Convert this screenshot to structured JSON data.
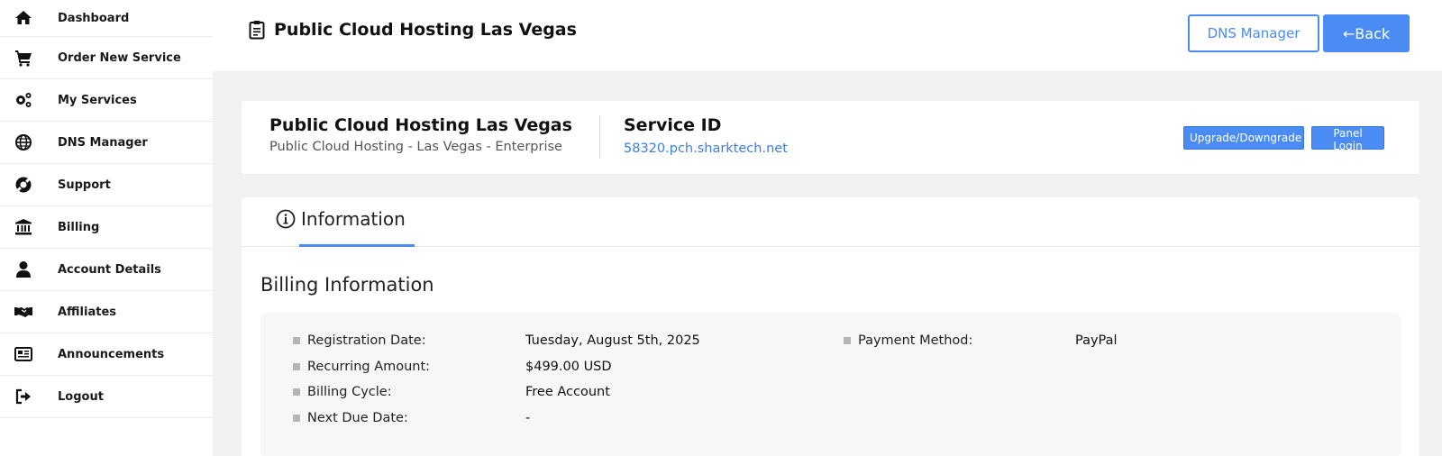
{
  "sidebar": {
    "items": [
      {
        "label": "Dashboard",
        "icon": "home-icon"
      },
      {
        "label": "Order New Service",
        "icon": "cart-icon"
      },
      {
        "label": "My Services",
        "icon": "gears-icon"
      },
      {
        "label": "DNS Manager",
        "icon": "globe-icon"
      },
      {
        "label": "Support",
        "icon": "lifebuoy-icon"
      },
      {
        "label": "Billing",
        "icon": "bank-icon"
      },
      {
        "label": "Account Details",
        "icon": "user-icon"
      },
      {
        "label": "Affiliates",
        "icon": "handshake-icon"
      },
      {
        "label": "Announcements",
        "icon": "newspaper-icon"
      },
      {
        "label": "Logout",
        "icon": "logout-icon"
      }
    ]
  },
  "header": {
    "title": "Public Cloud Hosting Las Vegas",
    "dns_button": "DNS Manager",
    "back_button": "Back"
  },
  "service": {
    "name": "Public Cloud Hosting Las Vegas",
    "subtitle": "Public Cloud Hosting - Las Vegas - Enterprise",
    "id_label": "Service ID",
    "id_value": "58320.pch.sharktech.net",
    "upgrade_button": "Upgrade/Downgrade",
    "panel_button": "Panel Login"
  },
  "tabs": {
    "information": "Information"
  },
  "billing": {
    "title": "Billing Information",
    "registration_label": "Registration Date:",
    "registration_value": "Tuesday, August 5th, 2025",
    "recurring_label": "Recurring Amount:",
    "recurring_value": "$499.00 USD",
    "cycle_label": "Billing Cycle:",
    "cycle_value": "Free Account",
    "next_due_label": "Next Due Date:",
    "next_due_value": "-",
    "payment_label": "Payment Method:",
    "payment_value": "PayPal"
  },
  "colors": {
    "accent": "#4a8cf3",
    "link": "#3b7de8"
  }
}
